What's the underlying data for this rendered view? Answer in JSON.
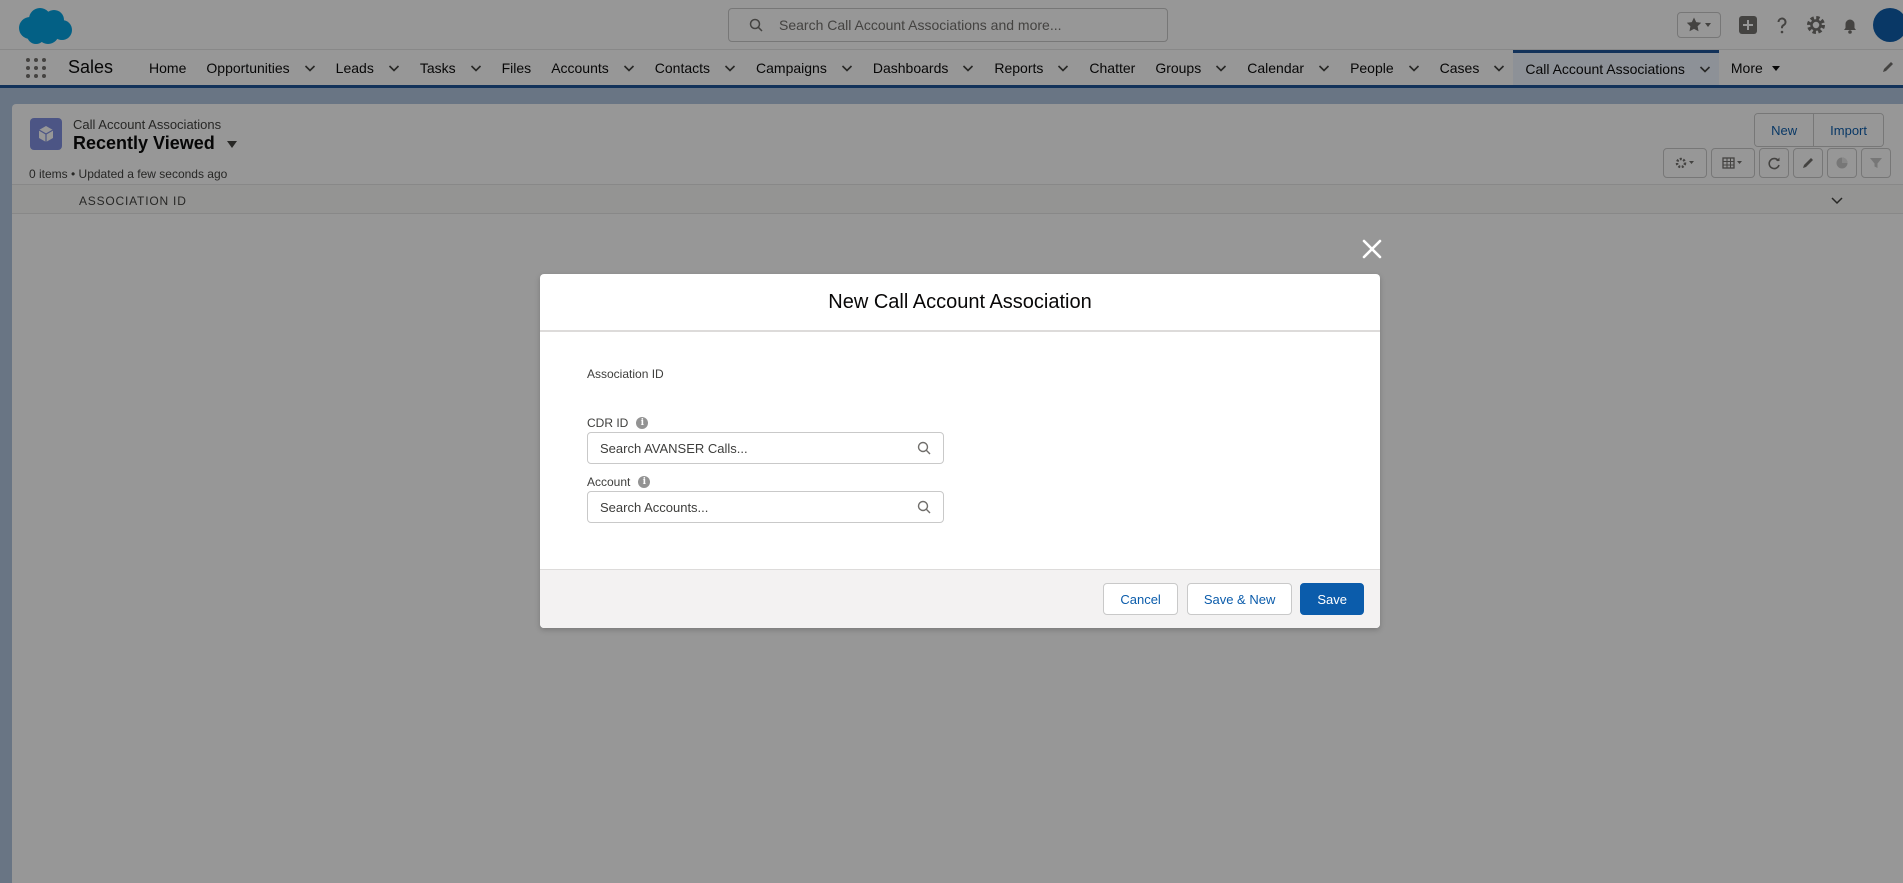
{
  "global_header": {
    "search_placeholder": "Search Call Account Associations and more..."
  },
  "nav": {
    "app_name": "Sales",
    "items": [
      {
        "label": "Home",
        "has_menu": false
      },
      {
        "label": "Opportunities",
        "has_menu": true
      },
      {
        "label": "Leads",
        "has_menu": true
      },
      {
        "label": "Tasks",
        "has_menu": true
      },
      {
        "label": "Files",
        "has_menu": false
      },
      {
        "label": "Accounts",
        "has_menu": true
      },
      {
        "label": "Contacts",
        "has_menu": true
      },
      {
        "label": "Campaigns",
        "has_menu": true
      },
      {
        "label": "Dashboards",
        "has_menu": true
      },
      {
        "label": "Reports",
        "has_menu": true
      },
      {
        "label": "Chatter",
        "has_menu": false
      },
      {
        "label": "Groups",
        "has_menu": true
      },
      {
        "label": "Calendar",
        "has_menu": true
      },
      {
        "label": "People",
        "has_menu": true
      },
      {
        "label": "Cases",
        "has_menu": true
      },
      {
        "label": "Call Account Associations",
        "has_menu": true,
        "active": true
      }
    ],
    "more_label": "More"
  },
  "list_view": {
    "object_label": "Call Account Associations",
    "title": "Recently Viewed",
    "meta": "0 items • Updated a few seconds ago",
    "new_label": "New",
    "import_label": "Import",
    "column_header": "ASSOCIATION ID"
  },
  "modal": {
    "title": "New Call Account Association",
    "association_id_label": "Association ID",
    "cdr_label": "CDR ID",
    "cdr_placeholder": "Search AVANSER Calls...",
    "account_label": "Account",
    "account_placeholder": "Search Accounts...",
    "cancel_label": "Cancel",
    "save_new_label": "Save & New",
    "save_label": "Save"
  },
  "colors": {
    "brand": "#0b5cab",
    "nav_accent": "#1b5297",
    "object_icon": "#7f8de1",
    "page_bg": "#b0c4df"
  },
  "icons": {
    "info": "i"
  }
}
